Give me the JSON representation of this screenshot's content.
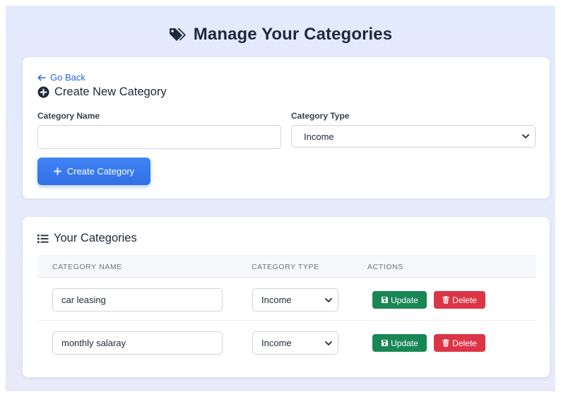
{
  "page": {
    "title": "Manage Your Categories",
    "title_icon": "tags-icon"
  },
  "create": {
    "back_label": "Go Back",
    "title": "Create New Category",
    "name_label": "Category Name",
    "name_value": "",
    "type_label": "Category Type",
    "type_selected": "Income",
    "button_label": "Create Category"
  },
  "list": {
    "title": "Your Categories",
    "columns": [
      "CATEGORY NAME",
      "CATEGORY TYPE",
      "ACTIONS"
    ],
    "rows": [
      {
        "name": "car leasing",
        "type": "Income",
        "update_label": "Update",
        "delete_label": "Delete"
      },
      {
        "name": "monthly salaray",
        "type": "Income",
        "update_label": "Update",
        "delete_label": "Delete"
      }
    ]
  },
  "colors": {
    "accent_blue": "#2f6fe7",
    "update_green": "#198754",
    "delete_red": "#dc3545",
    "title_dark": "#1e2a3c"
  }
}
